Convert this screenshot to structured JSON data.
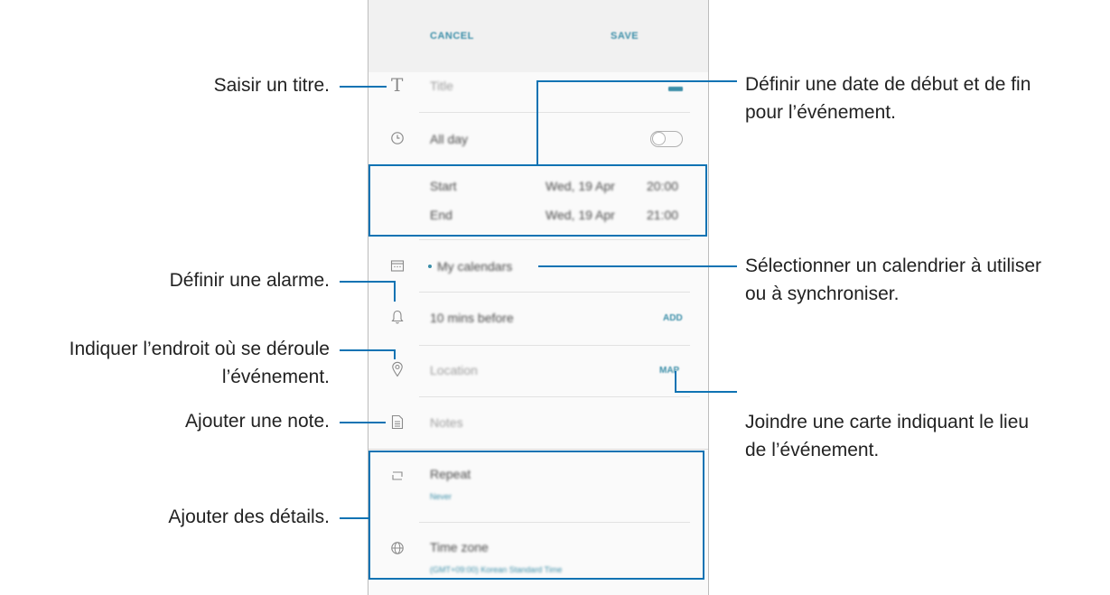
{
  "toolbar": {
    "cancel": "CANCEL",
    "save": "SAVE"
  },
  "form": {
    "title_placeholder": "Title",
    "all_day": "All day",
    "start_label": "Start",
    "start_date": "Wed, 19 Apr",
    "start_time": "20:00",
    "end_label": "End",
    "end_date": "Wed, 19 Apr",
    "end_time": "21:00",
    "calendar": "My calendars",
    "alarm": "10 mins before",
    "alarm_action": "ADD",
    "location_placeholder": "Location",
    "map_action": "MAP",
    "notes_placeholder": "Notes",
    "repeat": "Repeat",
    "repeat_value": "Never",
    "time_zone": "Time zone",
    "time_zone_value": "(GMT+09:00) Korean Standard Time"
  },
  "annotations": {
    "title": "Saisir un titre.",
    "alarm": "Définir une alarme.",
    "location_1": "Indiquer l’endroit où se déroule",
    "location_2": "l’événement.",
    "note": "Ajouter une note.",
    "details": "Ajouter des détails.",
    "dates_1": "Définir une date de début et de fin",
    "dates_2": "pour l’événement.",
    "calendar_1": "Sélectionner un calendrier à utiliser",
    "calendar_2": "ou à synchroniser.",
    "map_1": "Joindre une carte indiquant le lieu",
    "map_2": "de l’événement."
  },
  "colors": {
    "accent": "#0f73b3",
    "app_link": "#3b8ea8"
  }
}
